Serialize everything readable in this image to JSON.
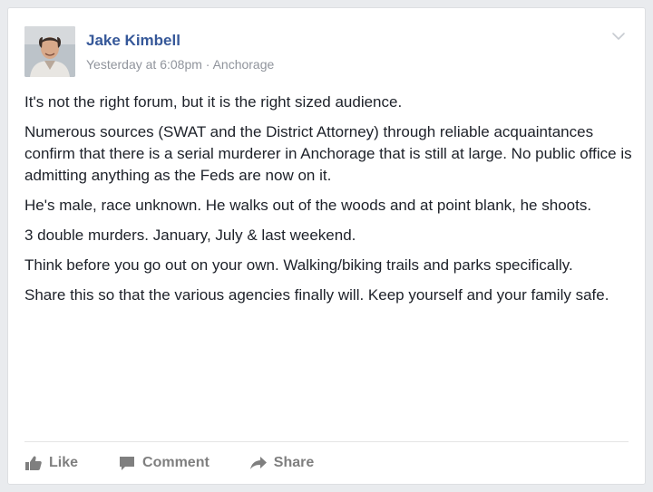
{
  "post": {
    "author": "Jake Kimbell",
    "timestamp": "Yesterday at 6:08pm",
    "separator": " · ",
    "location": "Anchorage",
    "paragraphs": [
      "It's not the right forum, but it is the right sized audience.",
      "Numerous sources (SWAT and the District Attorney) through reliable acquaintances confirm that there is a serial murderer in Anchorage that is still at large. No public office is admitting anything as the Feds are now on it.",
      "He's male, race unknown. He walks out of the woods and at point blank, he shoots.",
      "3 double murders. January, July & last weekend.",
      "Think before you go out on your own. Walking/biking trails and parks specifically.",
      "Share this so that the various agencies finally will. Keep yourself and your family safe."
    ]
  },
  "actions": {
    "like_label": "Like",
    "comment_label": "Comment",
    "share_label": "Share"
  },
  "icons": {
    "menu": "chevron-down-icon",
    "like": "thumbs-up-icon",
    "comment": "comment-icon",
    "share": "share-arrow-icon"
  },
  "colors": {
    "author_link": "#365899",
    "meta_text": "#90949c",
    "body_text": "#1d2129",
    "action_text": "#7f7f7f",
    "page_background": "#e9ebee"
  }
}
